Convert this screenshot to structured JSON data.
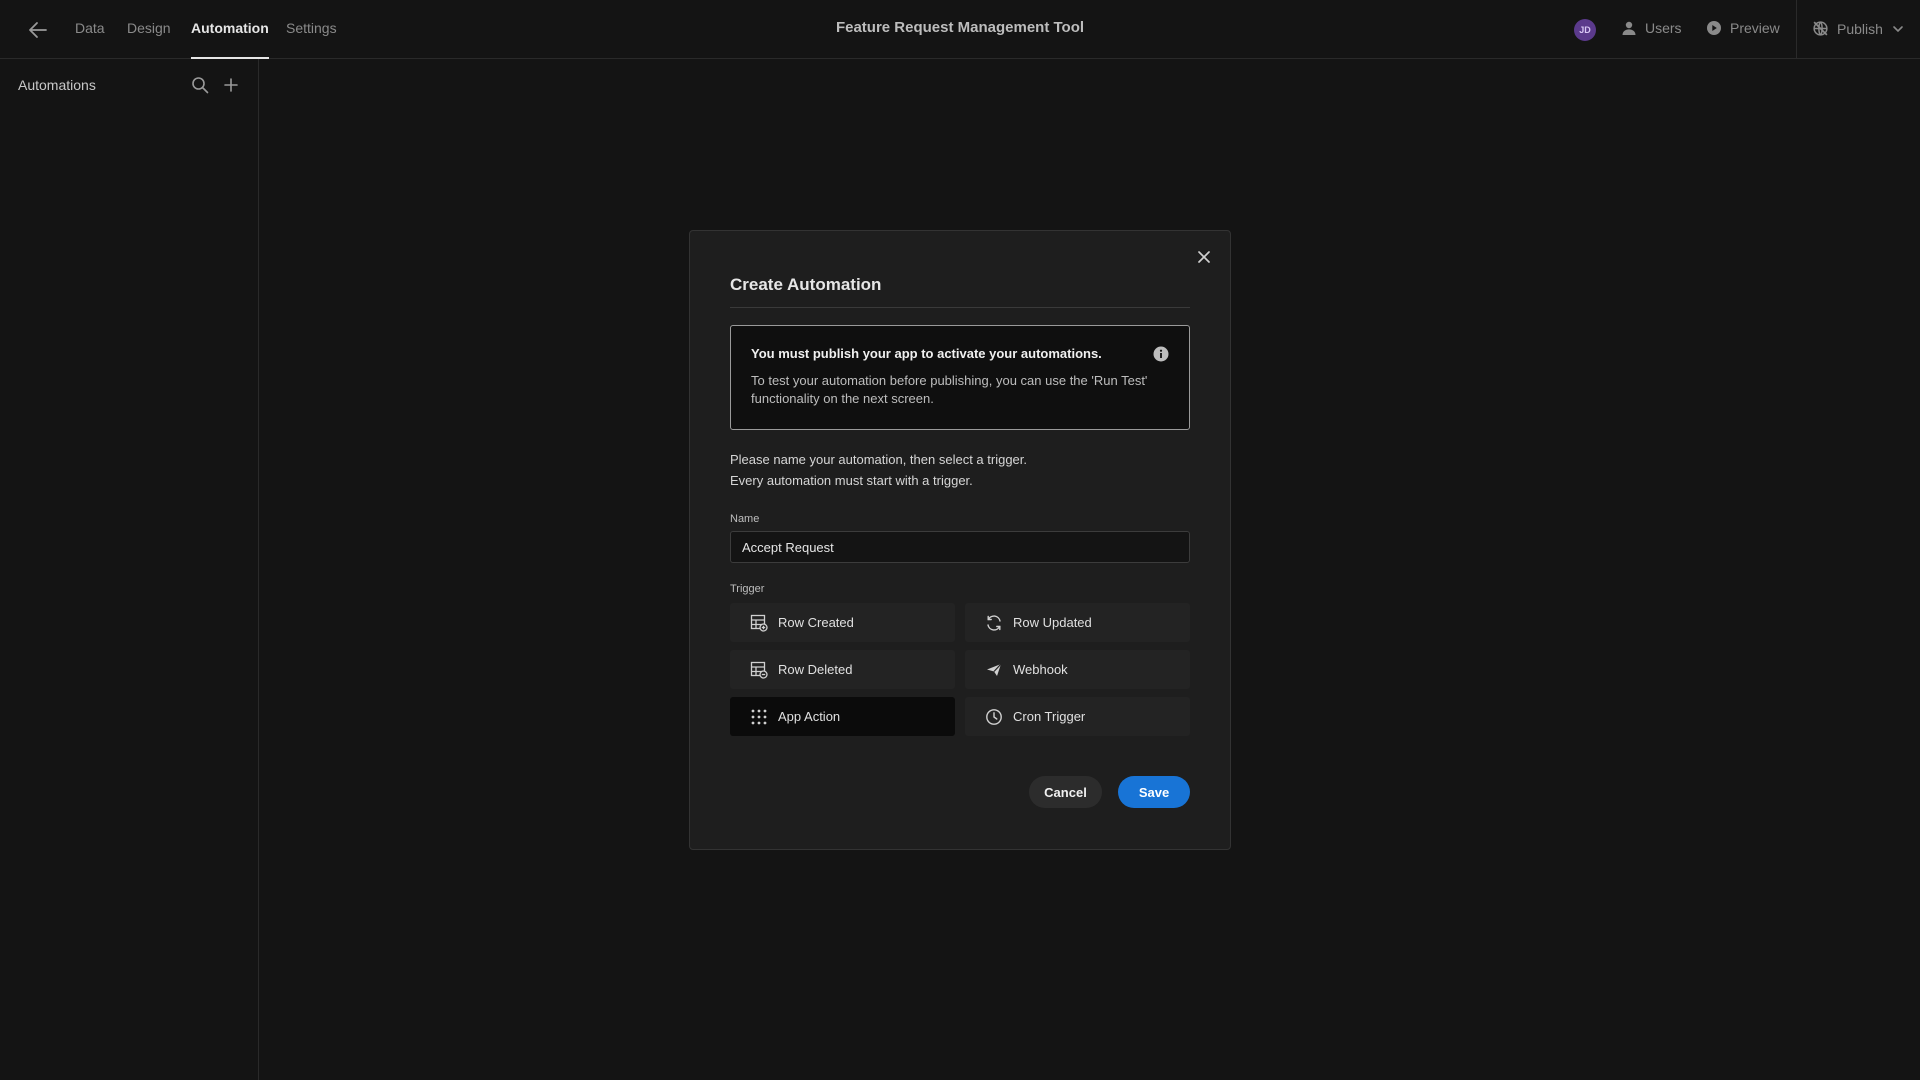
{
  "topbar": {
    "tabs": [
      {
        "label": "Data",
        "active": false
      },
      {
        "label": "Design",
        "active": false
      },
      {
        "label": "Automation",
        "active": true
      },
      {
        "label": "Settings",
        "active": false
      }
    ],
    "title": "Feature Request Management Tool",
    "avatar_initials": "JD",
    "users_label": "Users",
    "preview_label": "Preview",
    "publish_label": "Publish"
  },
  "sidebar": {
    "title": "Automations"
  },
  "modal": {
    "title": "Create Automation",
    "notice_title": "You must publish your app to activate your automations.",
    "notice_body": "To test your automation before publishing, you can use the 'Run Test' functionality on the next screen.",
    "intro_line1": "Please name your automation, then select a trigger.",
    "intro_line2": "Every automation must start with a trigger.",
    "name_label": "Name",
    "name_value": "Accept Request",
    "trigger_label": "Trigger",
    "triggers": [
      {
        "label": "Row Created",
        "icon": "table-add-icon",
        "selected": false
      },
      {
        "label": "Row Updated",
        "icon": "refresh-icon",
        "selected": false
      },
      {
        "label": "Row Deleted",
        "icon": "table-remove-icon",
        "selected": false
      },
      {
        "label": "Webhook",
        "icon": "send-icon",
        "selected": false
      },
      {
        "label": "App Action",
        "icon": "grid-dots-icon",
        "selected": true
      },
      {
        "label": "Cron Trigger",
        "icon": "clock-icon",
        "selected": false
      }
    ],
    "cancel_label": "Cancel",
    "save_label": "Save"
  },
  "colors": {
    "background": "#141414",
    "modal": "#1e1e1e",
    "accent": "#1874d6",
    "avatar": "#5b3a8c"
  }
}
